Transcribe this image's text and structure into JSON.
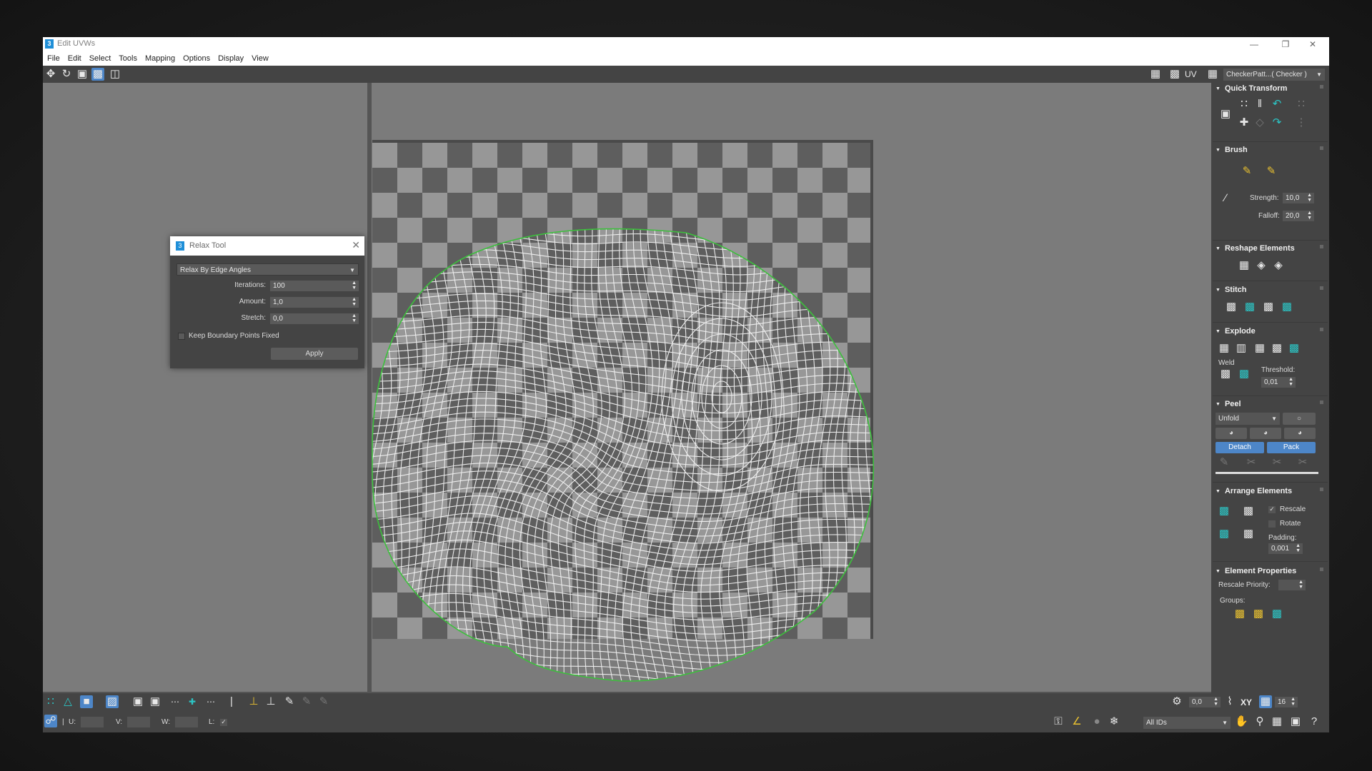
{
  "window": {
    "title": "Edit UVWs",
    "app_icon": "3ds-max-icon"
  },
  "menu": [
    "File",
    "Edit",
    "Select",
    "Tools",
    "Mapping",
    "Options",
    "Display",
    "View"
  ],
  "toolbar": {
    "uv_label": "UV",
    "map_dropdown": "CheckerPatt...( Checker )"
  },
  "relax_dialog": {
    "title": "Relax Tool",
    "method": "Relax By Edge Angles",
    "iterations_label": "Iterations:",
    "iterations": "100",
    "amount_label": "Amount:",
    "amount": "1,0",
    "stretch_label": "Stretch:",
    "stretch": "0,0",
    "keep_boundary_label": "Keep Boundary Points Fixed",
    "apply_label": "Apply"
  },
  "panel": {
    "quick_transform": "Quick Transform",
    "brush": "Brush",
    "strength_label": "Strength:",
    "strength": "10,0",
    "falloff_label": "Falloff:",
    "falloff": "20,0",
    "reshape": "Reshape Elements",
    "stitch": "Stitch",
    "explode": "Explode",
    "weld_label": "Weld",
    "threshold_label": "Threshold:",
    "threshold": "0,01",
    "peel": "Peel",
    "peel_mode": "Unfold",
    "detach_label": "Detach",
    "pack_label": "Pack",
    "arrange": "Arrange Elements",
    "rescale_label": "Rescale",
    "rotate_label": "Rotate",
    "padding_label": "Padding:",
    "padding": "0,001",
    "element_props": "Element Properties",
    "rescale_priority_label": "Rescale Priority:",
    "groups_label": "Groups:"
  },
  "bottom": {
    "angle_value": "0,0",
    "xy_label": "XY",
    "grid_value": "16",
    "u_label": "U:",
    "v_label": "V:",
    "w_label": "W:",
    "l_label": "L:",
    "ids_dropdown": "All IDs"
  },
  "colors": {
    "accent": "#4d86c8",
    "boundary": "#3cc03c",
    "teal_icon": "#2cc6c6"
  }
}
